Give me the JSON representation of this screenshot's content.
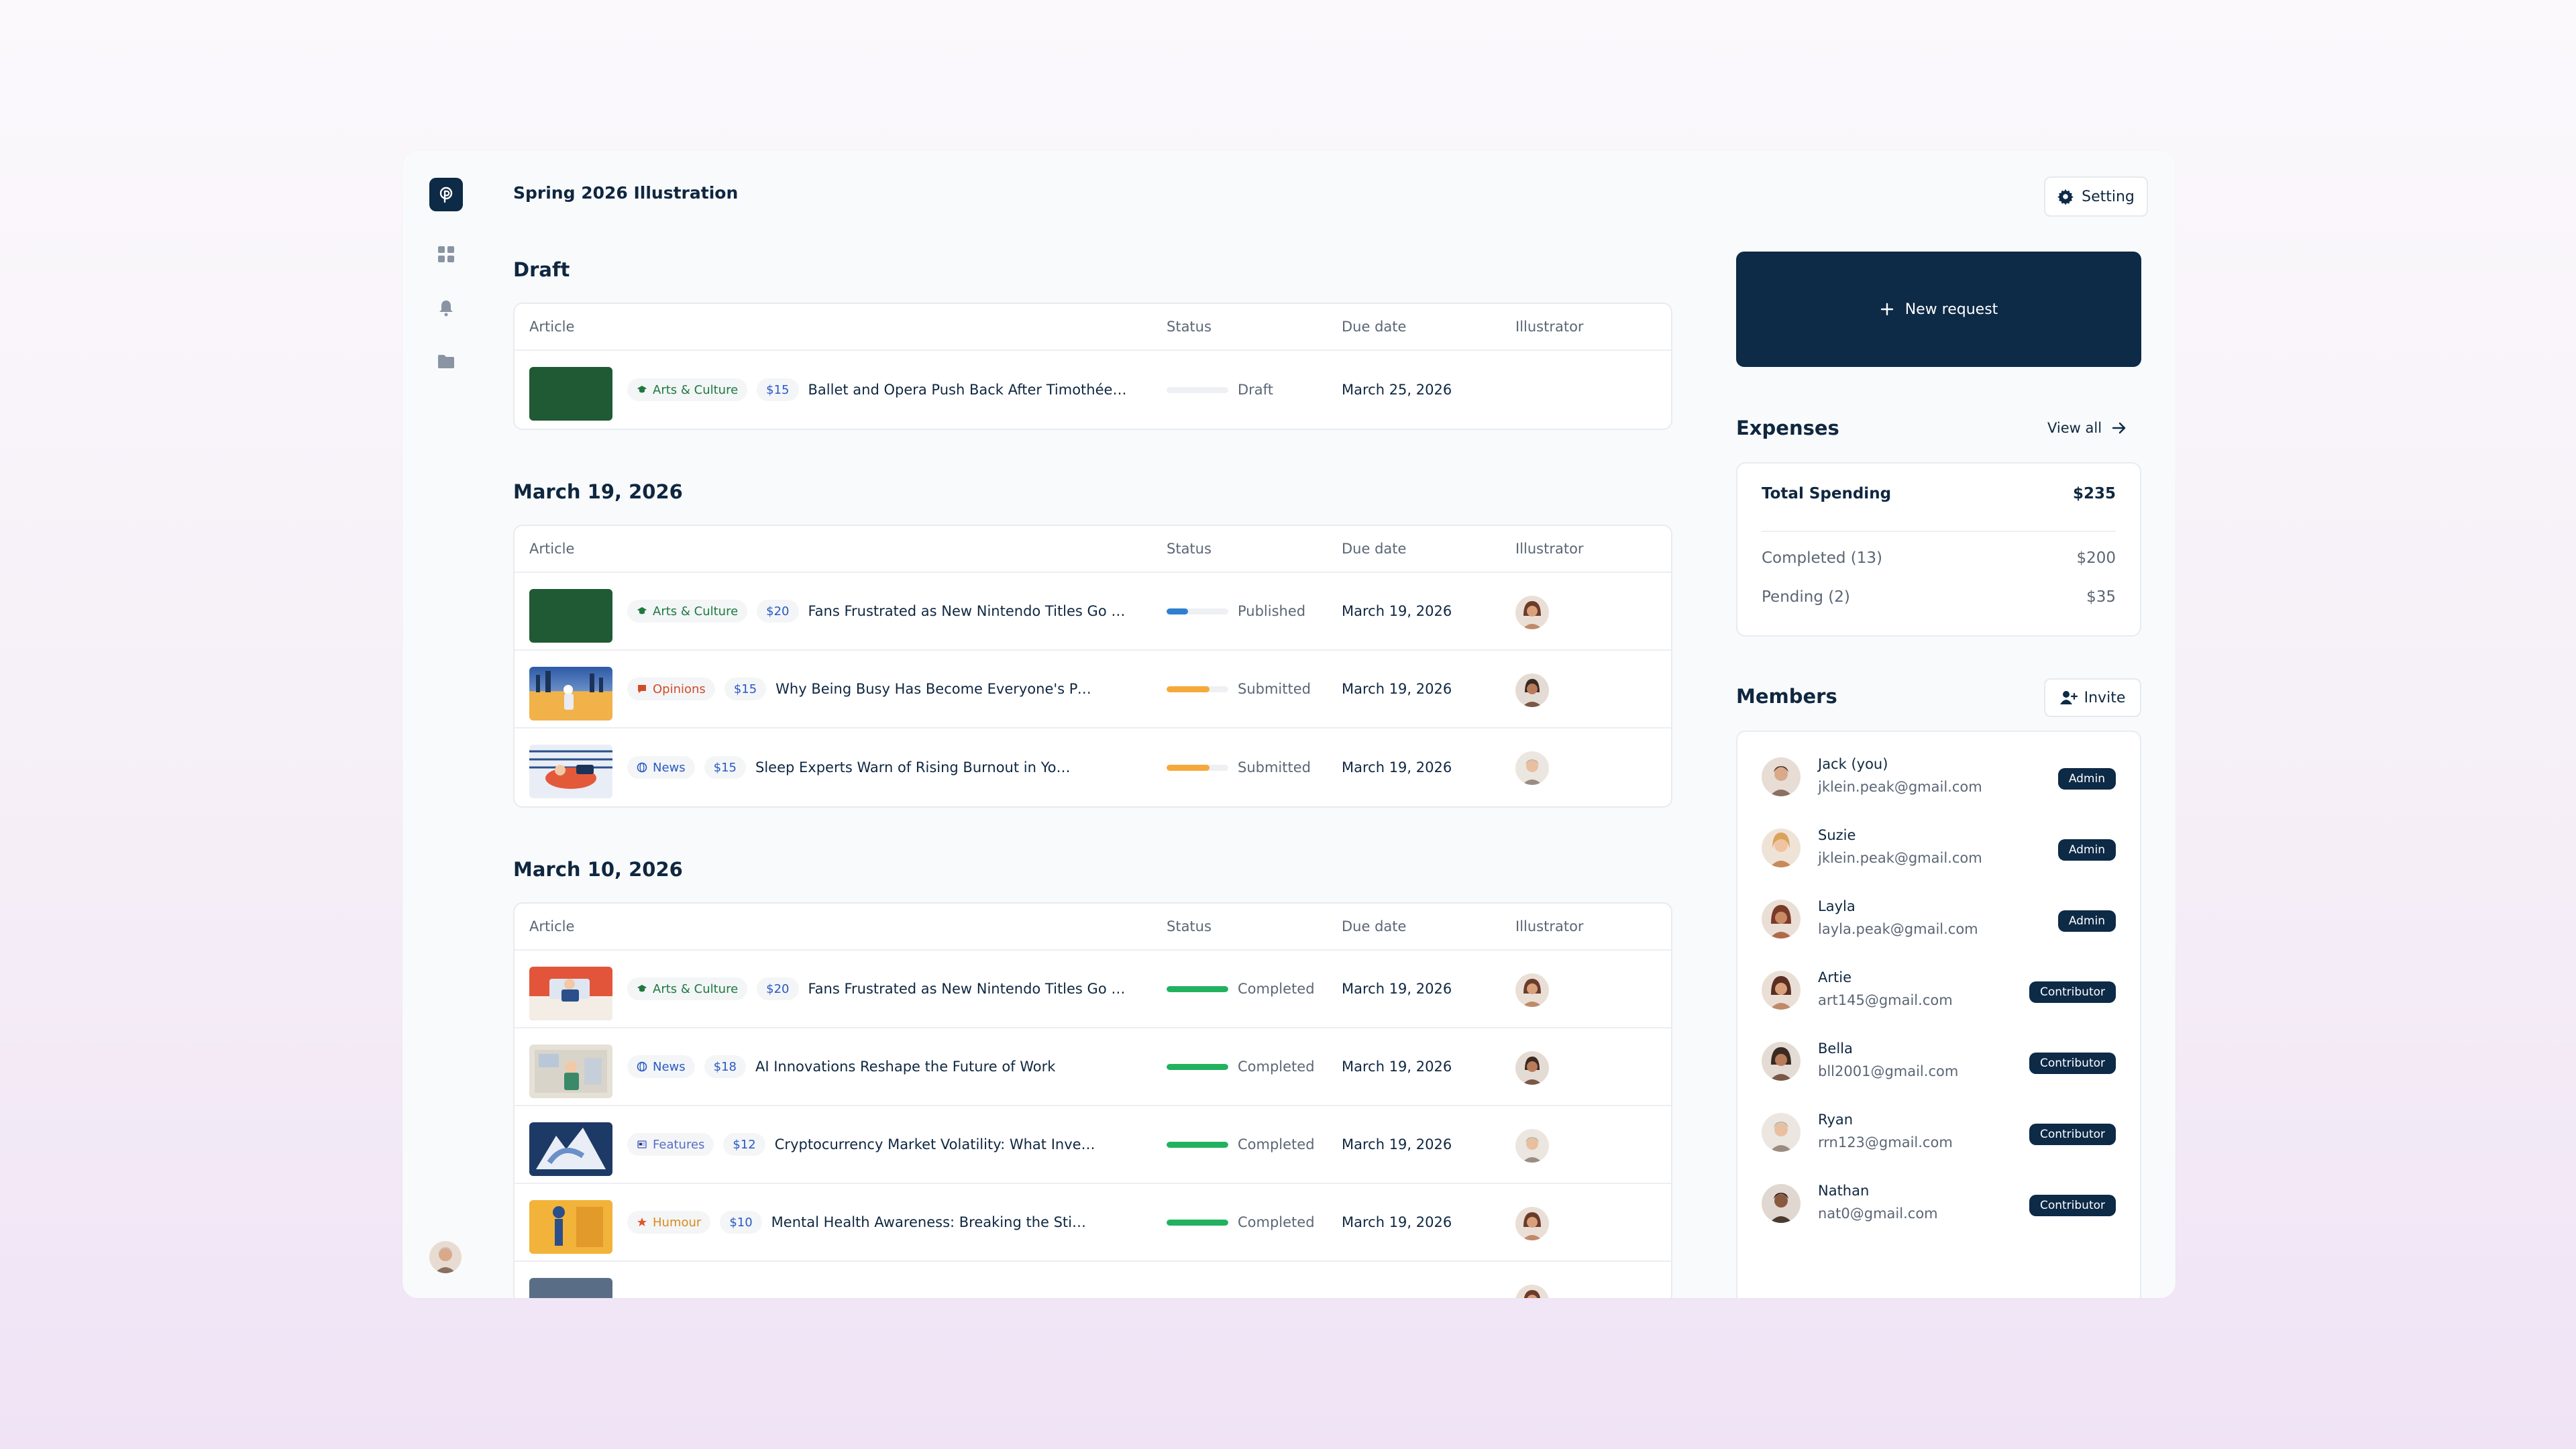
{
  "header": {
    "title": "Spring 2026 Illustration",
    "setting_label": "Setting"
  },
  "colors": {
    "navy": "#0d2a47",
    "green": "#22b25f",
    "blue": "#2f7fd1",
    "orange": "#f5a93a"
  },
  "columns": {
    "article": "Article",
    "status": "Status",
    "due": "Due date",
    "illustrator": "Illustrator"
  },
  "sections": [
    {
      "title": "Draft",
      "rows": [
        {
          "category": "Arts & Culture",
          "price": "$15",
          "title": "Ballet and Opera Push Back After Timothée C...",
          "status": "Draft",
          "progress": 0,
          "due": "March 25, 2026"
        }
      ]
    },
    {
      "title": "March 19, 2026",
      "rows": [
        {
          "category": "Arts & Culture",
          "price": "$20",
          "title": "Fans Frustrated as New Nintendo Titles Go S...",
          "status": "Published",
          "progress": 0.35,
          "due": "March 19, 2026"
        },
        {
          "category": "Opinions",
          "price": "$15",
          "title": "Why Being Busy Has Become Everyone's Personali...",
          "status": "Submitted",
          "progress": 0.7,
          "due": "March 19, 2026"
        },
        {
          "category": "News",
          "price": "$15",
          "title": "Sleep Experts Warn of Rising Burnout in Young Adults",
          "status": "Submitted",
          "progress": 0.7,
          "due": "March 19, 2026"
        }
      ]
    },
    {
      "title": "March 10, 2026",
      "rows": [
        {
          "category": "Arts & Culture",
          "price": "$20",
          "title": "Fans Frustrated as New Nintendo Titles Go S...",
          "status": "Completed",
          "progress": 1,
          "due": "March 19, 2026"
        },
        {
          "category": "News",
          "price": "$18",
          "title": "AI Innovations Reshape the Future of Work",
          "status": "Completed",
          "progress": 1,
          "due": "March 19, 2026"
        },
        {
          "category": "Features",
          "price": "$12",
          "title": "Cryptocurrency Market Volatility: What Investors...",
          "status": "Completed",
          "progress": 1,
          "due": "March 19, 2026"
        },
        {
          "category": "Humour",
          "price": "$10",
          "title": "Mental Health Awareness: Breaking the Stigma",
          "status": "Completed",
          "progress": 1,
          "due": "March 19, 2026"
        }
      ]
    }
  ],
  "new_request": {
    "label": "New request"
  },
  "expenses": {
    "title": "Expenses",
    "view_all": "View all",
    "total_label": "Total Spending",
    "total_value": "$235",
    "completed_label": "Completed (13)",
    "completed_value": "$200",
    "pending_label": "Pending (2)",
    "pending_value": "$35"
  },
  "members": {
    "title": "Members",
    "invite_label": "Invite",
    "list": [
      {
        "name": "Jack (you)",
        "email": "jklein.peak@gmail.com",
        "role": "Admin"
      },
      {
        "name": "Suzie",
        "email": "jklein.peak@gmail.com",
        "role": "Admin"
      },
      {
        "name": "Layla",
        "email": "layla.peak@gmail.com",
        "role": "Admin"
      },
      {
        "name": "Artie",
        "email": "art145@gmail.com",
        "role": "Contributor"
      },
      {
        "name": "Bella",
        "email": "bll2001@gmail.com",
        "role": "Contributor"
      },
      {
        "name": "Ryan",
        "email": "rrn123@gmail.com",
        "role": "Contributor"
      },
      {
        "name": "Nathan",
        "email": "nat0@gmail.com",
        "role": "Contributor"
      }
    ]
  }
}
